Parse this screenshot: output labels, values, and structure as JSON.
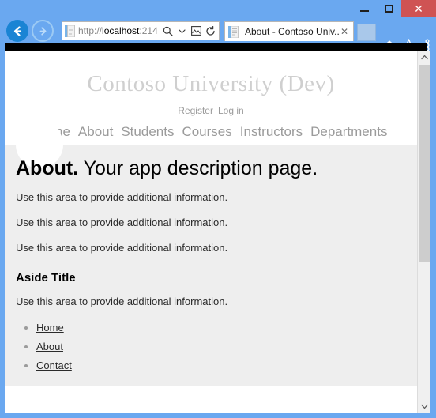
{
  "browser": {
    "window_controls": {
      "minimize_label": "—",
      "maximize_label": "□",
      "close_label": "✕"
    },
    "back_button_label": "Back",
    "forward_button_label": "Forward",
    "address": {
      "scheme": "http://",
      "host": "localhost",
      "port": ":214",
      "full_text": "http://localhost:214",
      "search_icon": "search-icon",
      "dropdown_icon": "chevron-down-icon",
      "compat_icon": "compatibility-view-icon",
      "refresh_icon": "refresh-icon"
    },
    "tab": {
      "title": "About - Contoso Univ...",
      "close_label": "✕"
    },
    "new_tab_label": "",
    "toolbar_icons": [
      {
        "name": "home-icon",
        "glyph": "⌂"
      },
      {
        "name": "favorites-star-icon",
        "glyph": "★"
      },
      {
        "name": "tools-gear-icon",
        "glyph": "⚙"
      }
    ]
  },
  "page": {
    "brand": "Contoso University (Dev)",
    "auth_links": [
      {
        "label": "Register"
      },
      {
        "label": "Log in"
      }
    ],
    "nav_links": [
      {
        "label": "Home"
      },
      {
        "label": "About"
      },
      {
        "label": "Students"
      },
      {
        "label": "Courses"
      },
      {
        "label": "Instructors"
      },
      {
        "label": "Departments"
      }
    ],
    "title_bold": "About.",
    "title_rest": "Your app description page.",
    "paragraphs": [
      "Use this area to provide additional information.",
      "Use this area to provide additional information.",
      "Use this area to provide additional information."
    ],
    "aside_title": "Aside Title",
    "aside_paragraph": "Use this area to provide additional information.",
    "aside_links": [
      {
        "label": "Home"
      },
      {
        "label": "About"
      },
      {
        "label": "Contact"
      }
    ]
  },
  "scrollbar": {
    "up_arrow": "⌃",
    "down_arrow": "⌄"
  },
  "colors": {
    "chrome_blue": "#6aa8f0",
    "close_red": "#cf5353",
    "content_gray": "#eeeeee",
    "brand_gray": "#cfcfcf"
  }
}
